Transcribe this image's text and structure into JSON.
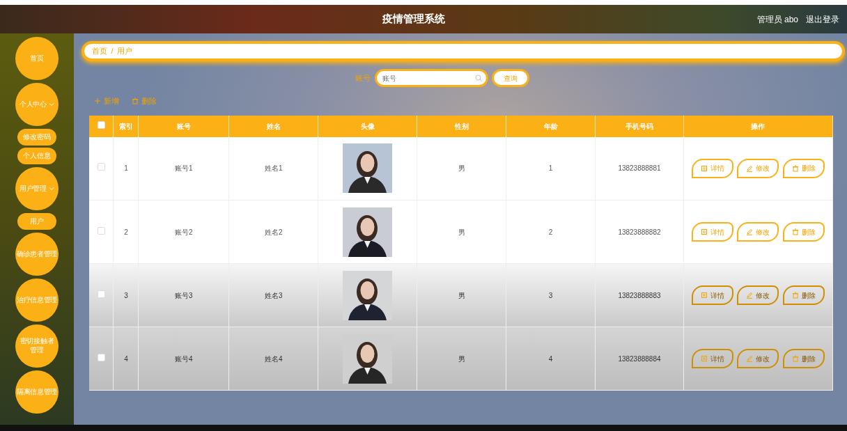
{
  "header": {
    "title": "疫情管理系统",
    "user": "管理员 abo",
    "logout": "退出登录"
  },
  "sidebar": {
    "items": [
      {
        "label": "首页"
      },
      {
        "label": "个人中心",
        "expanded": true,
        "children": [
          {
            "label": "修改密码"
          },
          {
            "label": "个人信息"
          }
        ]
      },
      {
        "label": "用户管理",
        "expanded": true,
        "children": [
          {
            "label": "用户"
          }
        ]
      },
      {
        "label": "确诊患者管理"
      },
      {
        "label": "治疗信息管理"
      },
      {
        "label": "密切接触者管理"
      },
      {
        "label": "隔离信息管理"
      }
    ]
  },
  "breadcrumb": {
    "items": [
      "首页",
      "用户"
    ],
    "separator": "/"
  },
  "search": {
    "label": "账号",
    "placeholder": "账号",
    "button": "查询"
  },
  "actions": [
    {
      "kind": "add",
      "label": "新增"
    },
    {
      "kind": "delete",
      "label": "删除"
    }
  ],
  "table": {
    "all_selected": false,
    "columns": [
      "索引",
      "账号",
      "姓名",
      "头像",
      "性别",
      "年龄",
      "手机号码",
      "操作"
    ],
    "rows": [
      {
        "selected": false,
        "index": "1",
        "account": "账号1",
        "name": "姓名1",
        "avatar": {
          "kind": "picture"
        },
        "gender": "男",
        "age": "1",
        "phone": "13823888881",
        "buttons": [
          {
            "kind": "detail",
            "label": "详情"
          },
          {
            "kind": "edit",
            "label": "修改"
          },
          {
            "kind": "delete",
            "label": "删除"
          }
        ]
      },
      {
        "selected": false,
        "index": "2",
        "account": "账号2",
        "name": "姓名2",
        "avatar": {
          "kind": "picture"
        },
        "gender": "男",
        "age": "2",
        "phone": "13823888882",
        "buttons": [
          {
            "kind": "detail",
            "label": "详情"
          },
          {
            "kind": "edit",
            "label": "修改"
          },
          {
            "kind": "delete",
            "label": "删除"
          }
        ]
      },
      {
        "selected": false,
        "index": "3",
        "account": "账号3",
        "name": "姓名3",
        "avatar": {
          "kind": "picture"
        },
        "gender": "男",
        "age": "3",
        "phone": "13823888883",
        "buttons": [
          {
            "kind": "detail",
            "label": "详情"
          },
          {
            "kind": "edit",
            "label": "修改"
          },
          {
            "kind": "delete",
            "label": "删除"
          }
        ]
      },
      {
        "selected": false,
        "index": "4",
        "account": "账号4",
        "name": "姓名4",
        "avatar": {
          "kind": "picture"
        },
        "gender": "男",
        "age": "4",
        "phone": "13823888884",
        "buttons": [
          {
            "kind": "detail",
            "label": "详情"
          },
          {
            "kind": "edit",
            "label": "修改"
          },
          {
            "kind": "delete",
            "label": "删除"
          }
        ]
      }
    ]
  }
}
